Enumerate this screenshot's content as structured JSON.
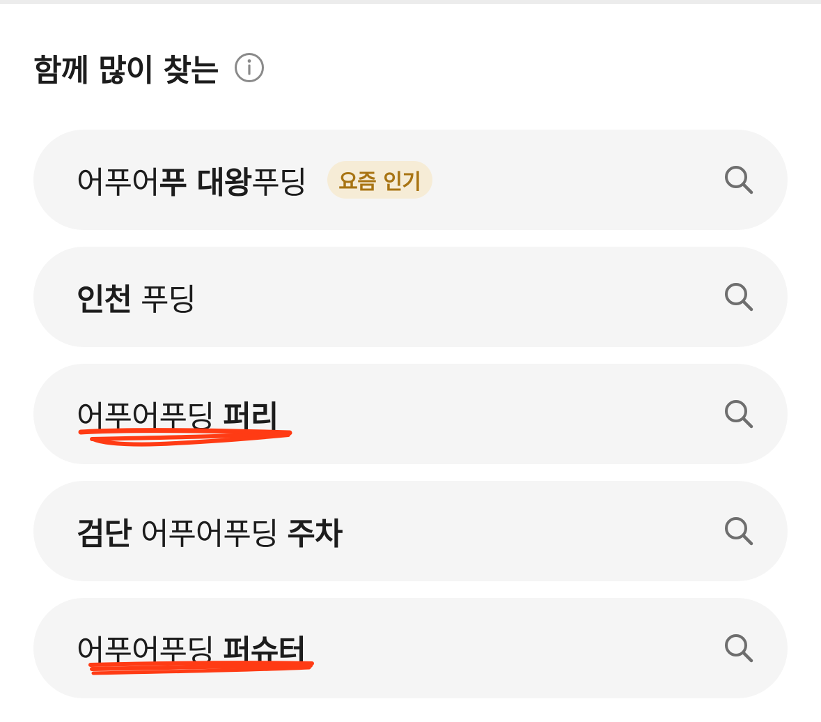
{
  "section": {
    "title": "함께 많이 찾는",
    "info_icon": "info-circle-icon"
  },
  "suggestions": [
    {
      "parts": [
        {
          "text": "어푸어",
          "bold": false
        },
        {
          "text": "푸 대왕",
          "bold": true
        },
        {
          "text": "푸딩",
          "bold": false
        }
      ],
      "badge": "요즘 인기",
      "icon": "search-icon"
    },
    {
      "parts": [
        {
          "text": "인천",
          "bold": true
        },
        {
          "text": " 푸딩",
          "bold": false
        }
      ],
      "icon": "search-icon"
    },
    {
      "parts": [
        {
          "text": "어푸어푸딩 ",
          "bold": false
        },
        {
          "text": "퍼리",
          "bold": true
        }
      ],
      "icon": "search-icon"
    },
    {
      "parts": [
        {
          "text": "검단",
          "bold": true
        },
        {
          "text": " 어푸어푸딩 ",
          "bold": false
        },
        {
          "text": "주차",
          "bold": true
        }
      ],
      "icon": "search-icon"
    },
    {
      "parts": [
        {
          "text": "어푸어푸딩 ",
          "bold": false
        },
        {
          "text": "퍼슈터",
          "bold": true
        }
      ],
      "icon": "search-icon"
    }
  ],
  "colors": {
    "pill_bg": "#f5f5f5",
    "badge_bg": "#f6ecd6",
    "badge_text": "#a87413",
    "annotation": "#ff3b14"
  }
}
